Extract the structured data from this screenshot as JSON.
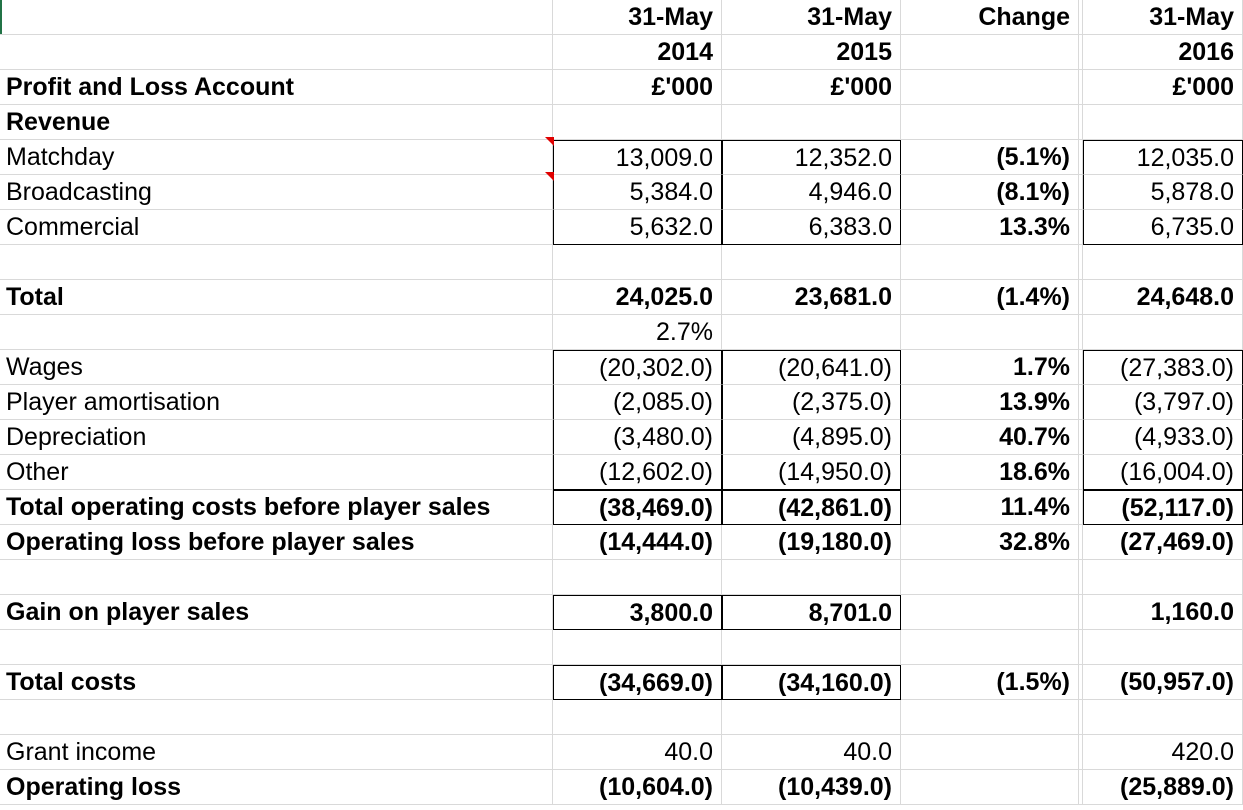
{
  "header": {
    "col_2014": [
      "31-May",
      "2014",
      "£'000"
    ],
    "col_2015": [
      "31-May",
      "2015",
      "£'000"
    ],
    "col_change": [
      "Change",
      "",
      ""
    ],
    "col_2016": [
      "31-May",
      "2016",
      "£'000"
    ],
    "title": "Profit and Loss Account"
  },
  "rows": [
    {
      "label": "Revenue",
      "bold": true,
      "v14": "",
      "v15": "",
      "chg": "",
      "v16": ""
    },
    {
      "label": "Matchday",
      "bold": false,
      "v14": "13,009.0",
      "v15": "12,352.0",
      "chg": "(5.1%)",
      "v16": "12,035.0"
    },
    {
      "label": "Broadcasting",
      "bold": false,
      "v14": "5,384.0",
      "v15": "4,946.0",
      "chg": "(8.1%)",
      "v16": "5,878.0"
    },
    {
      "label": "Commercial",
      "bold": false,
      "v14": "5,632.0",
      "v15": "6,383.0",
      "chg": "13.3%",
      "v16": "6,735.0"
    },
    {
      "label": "",
      "bold": false,
      "v14": "",
      "v15": "",
      "chg": "",
      "v16": ""
    },
    {
      "label": "Total",
      "bold": true,
      "v14": "24,025.0",
      "v15": "23,681.0",
      "chg": "(1.4%)",
      "v16": "24,648.0"
    },
    {
      "label": "",
      "bold": false,
      "v14": "2.7%",
      "v15": "",
      "chg": "",
      "v16": ""
    },
    {
      "label": "Wages",
      "bold": false,
      "v14": "(20,302.0)",
      "v15": "(20,641.0)",
      "chg": "1.7%",
      "v16": "(27,383.0)"
    },
    {
      "label": "Player amortisation",
      "bold": false,
      "v14": "(2,085.0)",
      "v15": "(2,375.0)",
      "chg": "13.9%",
      "v16": "(3,797.0)"
    },
    {
      "label": "Depreciation",
      "bold": false,
      "v14": "(3,480.0)",
      "v15": "(4,895.0)",
      "chg": "40.7%",
      "v16": "(4,933.0)"
    },
    {
      "label": "Other",
      "bold": false,
      "v14": "(12,602.0)",
      "v15": "(14,950.0)",
      "chg": "18.6%",
      "v16": "(16,004.0)"
    },
    {
      "label": "Total operating costs before player sales",
      "bold": true,
      "v14": "(38,469.0)",
      "v15": "(42,861.0)",
      "chg": "11.4%",
      "v16": "(52,117.0)"
    },
    {
      "label": "Operating loss before player sales",
      "bold": true,
      "v14": "(14,444.0)",
      "v15": "(19,180.0)",
      "chg": "32.8%",
      "v16": "(27,469.0)"
    },
    {
      "label": "",
      "bold": false,
      "v14": "",
      "v15": "",
      "chg": "",
      "v16": ""
    },
    {
      "label": "Gain on player sales",
      "bold": true,
      "v14": "3,800.0",
      "v15": "8,701.0",
      "chg": "",
      "v16": "1,160.0"
    },
    {
      "label": "",
      "bold": false,
      "v14": "",
      "v15": "",
      "chg": "",
      "v16": ""
    },
    {
      "label": "Total costs",
      "bold": true,
      "v14": "(34,669.0)",
      "v15": "(34,160.0)",
      "chg": "(1.5%)",
      "v16": "(50,957.0)"
    },
    {
      "label": "",
      "bold": false,
      "v14": "",
      "v15": "",
      "chg": "",
      "v16": ""
    },
    {
      "label": "Grant income",
      "bold": false,
      "v14": "40.0",
      "v15": "40.0",
      "chg": "",
      "v16": "420.0"
    },
    {
      "label": "Operating loss",
      "bold": true,
      "v14": "(10,604.0)",
      "v15": "(10,439.0)",
      "chg": "",
      "v16": "(25,889.0)"
    }
  ],
  "colors": {
    "gridline": "#d9d9d9",
    "comment_marker": "#e00000",
    "selection": "#217346"
  }
}
